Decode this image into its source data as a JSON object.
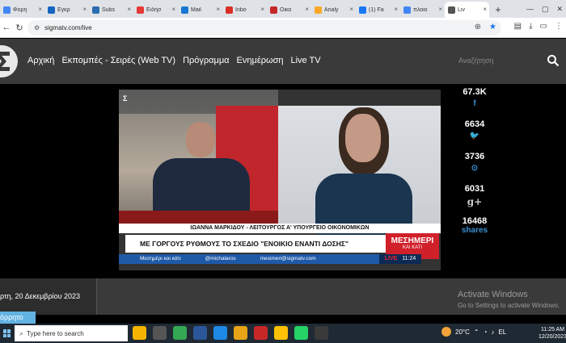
{
  "browser": {
    "tabs": [
      {
        "label": "Φορη",
        "color": "#4285f4"
      },
      {
        "label": "Εγκρ",
        "color": "#1565c0"
      },
      {
        "label": "Subs",
        "color": "#2b6cb0"
      },
      {
        "label": "Ειδήσ",
        "color": "#e53935"
      },
      {
        "label": "Mail",
        "color": "#1976d2"
      },
      {
        "label": "Inbo",
        "color": "#d93025"
      },
      {
        "label": "Οικο",
        "color": "#c62828"
      },
      {
        "label": "Analy",
        "color": "#f9a825"
      },
      {
        "label": "(1) Fa",
        "color": "#1877f2"
      },
      {
        "label": "πλοιο",
        "color": "#4285f4"
      },
      {
        "label": "Liv",
        "color": "#555555"
      }
    ],
    "new_tab": "+",
    "url": "sigmatv.com/live"
  },
  "site": {
    "nav": [
      "Αρχική",
      "Εκπομπές - Σειρές (Web TV)",
      "Πρόγραμμα",
      "Ενημέρωση",
      "Live TV"
    ],
    "search_placeholder": "Αναζήτηση"
  },
  "video": {
    "lower_third_name": "ΙΩΑΝΝΑ ΜΑΡΚΙΔΟΥ - ΛΕΙΤΟΥΡΓΟΣ Α' ΥΠΟΥΡΓΕΙΟ ΟΙΚΟΝΟΜΙΚΩΝ",
    "headline": "ΜΕ ΓΟΡΓΟΥΣ ΡΥΘΜΟΥΣ ΤΟ ΣΧΕΔΙΟ \"ΕΝΟΙΚΙΟ ΕΝΑΝΤΙ ΔΟΣΗΣ\"",
    "show_title": "ΜΕΣΗΜΕΡΙ",
    "show_subtitle": "ΚΑΙ ΚΑΤΙ",
    "ticker": [
      "Μεσημέρι και κάτι",
      "@michalaros",
      "mesimeri@sigmatv.com"
    ],
    "live_label": "LIVE",
    "live_time": "11:24",
    "channel_logo": "Σ"
  },
  "shares": {
    "items": [
      {
        "count": "67.3K",
        "icon": "f"
      },
      {
        "count": "6634",
        "icon": "🐦"
      },
      {
        "count": "3736",
        "icon": "⊙"
      },
      {
        "count": "6031",
        "icon": "g+"
      },
      {
        "count": "16468",
        "icon": ""
      }
    ],
    "label": "shares"
  },
  "date_text": "ρτη, 20 Δεκεμβρίου 2023",
  "more_button": "όρρητο",
  "watermark": {
    "line1": "Activate Windows",
    "line2": "Go to Settings to activate Windows."
  },
  "taskbar": {
    "search_placeholder": "Type here to search",
    "apps": [
      "#f4b400",
      "#555555",
      "#34a853",
      "#2b579a",
      "#1e88e5",
      "#e8a317",
      "#c62828",
      "#ffc107",
      "#25d366",
      "#3a3a3a"
    ],
    "temperature": "20°C",
    "language": "EL",
    "time": "11:25 AM",
    "date": "12/20/2023"
  }
}
